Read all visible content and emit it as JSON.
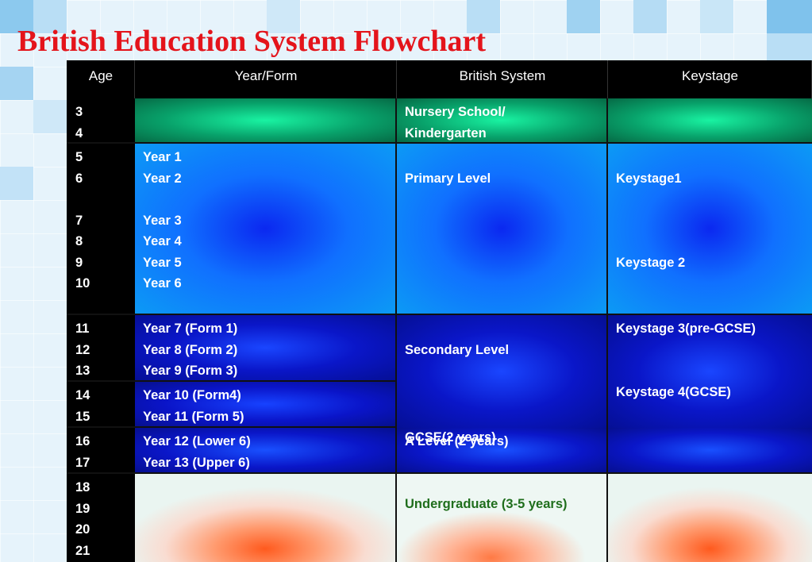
{
  "page": {
    "title": "British Education System Flowchart"
  },
  "table": {
    "headers": [
      "Age",
      "Year/Form",
      "British System",
      "Keystage"
    ],
    "nursery": {
      "ages": "3\n4",
      "system": "Nursery School/\nKindergarten"
    },
    "primary": {
      "ages": "5\n6\n\n7\n8\n9\n10",
      "years": "Year 1\nYear 2\n\nYear 3\nYear 4\nYear 5\nYear 6",
      "system": "\nPrimary Level",
      "keystage": "\nKeystage1\n\n\n\nKeystage 2"
    },
    "lower_secondary": {
      "ages": "11\n12\n13",
      "years": "Year 7 (Form 1)\nYear 8 (Form 2)\nYear 9 (Form 3)",
      "system": "Secondary Level",
      "keystage": "Keystage 3(pre-GCSE)\n\n\nKeystage 4(GCSE)"
    },
    "gcse": {
      "ages": "14\n15",
      "years": "Year 10 (Form4)\nYear 11 (Form 5)",
      "system": "GCSE(2 years)"
    },
    "sixth_form": {
      "ages": "16\n17",
      "years": "Year 12 (Lower 6)\nYear 13 (Upper 6)",
      "system": "A Level (2 years)"
    },
    "university": {
      "ages": "18\n19\n20\n21",
      "system": "Undergraduate (3-5 years)"
    }
  },
  "colors": {
    "title": "#e4141b",
    "nursery_row": "#0fc985",
    "primary_row": "#1070ff",
    "secondary_row": "#0a16c8",
    "university_row": "#ff5a1e",
    "university_text": "#1f6e1c"
  }
}
